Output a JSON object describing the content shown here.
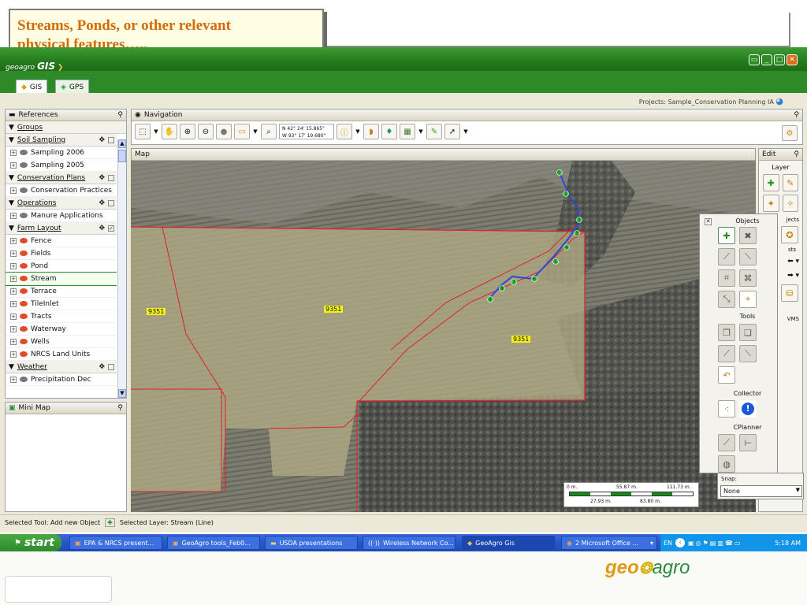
{
  "slide": {
    "caption_line1": "Streams, Ponds, or other relevant",
    "caption_line2": "physical features…..",
    "footer_logo_geo": "geo",
    "footer_logo_agro": "agro"
  },
  "window": {
    "logo_small": "geoagro",
    "logo_big": "GIS",
    "btn_restore": "▭",
    "btn_min": "_",
    "btn_max": "□",
    "btn_close": "✕",
    "colors": {
      "title_green": "#267d1f",
      "accent_orange": "#d46b07"
    }
  },
  "tabs": [
    {
      "label": "GIS"
    },
    {
      "label": "GPS"
    }
  ],
  "projects_label": "Projects: Sample_Conservation Planning IA",
  "references": {
    "title": "References",
    "groups_label": "Groups",
    "groups": [
      {
        "name": "Soil Sampling",
        "layers": [
          "Sampling 2006",
          "Sampling 2005"
        ]
      },
      {
        "name": "Conservation Plans",
        "layers": [
          "Conservation Practices"
        ]
      },
      {
        "name": "Operations",
        "layers": [
          "Manure Applications"
        ]
      },
      {
        "name": "Farm Layout",
        "layers": [
          "Fence",
          "Fields",
          "Pond",
          "Stream",
          "Terrace",
          "TileInlet",
          "Tracts",
          "Waterway",
          "Wells",
          "NRCS Land Units"
        ]
      },
      {
        "name": "Weather",
        "layers": [
          "Precipitation Dec"
        ]
      }
    ]
  },
  "minimap": {
    "title": "Mini Map"
  },
  "navigation": {
    "title": "Navigation",
    "coord_lat": "N 42° 24' 15.865\"",
    "coord_lon": "W 93° 17' 19.680\""
  },
  "map": {
    "title": "Map",
    "parcel_labels": [
      "9351",
      "9351",
      "9351"
    ],
    "stream_points": [
      "0",
      "1",
      "2",
      "3",
      "4",
      "5",
      "6",
      "7",
      "8",
      "9"
    ],
    "scale": {
      "top0": "0 m.",
      "top1": "55.87 m.",
      "top2": "111.73 m.",
      "bottom1": "27.93 m.",
      "bottom2": "83.80 m."
    }
  },
  "edit": {
    "title": "Edit",
    "layer_label": "Layer",
    "objects_partial": "jects",
    "sts_partial": "sts",
    "wms_partial": "VMS"
  },
  "objects_panel": {
    "objects": "Objects",
    "tools": "Tools",
    "collector": "Collector",
    "cplanner": "CPlanner",
    "snap_label": "Snap:",
    "snap_value": "None"
  },
  "status": {
    "selected_tool": "Selected Tool: Add new Object",
    "selected_layer": "Selected Layer: Stream (Line)"
  },
  "taskbar": {
    "start": "start",
    "tasks": [
      "EPA & NRCS present...",
      "GeoAgro tools_Feb0...",
      "USDA presentations",
      "Wireless Network Co...",
      "GeoAgro Gis",
      "2 Microsoft Office ..."
    ],
    "lang": "EN",
    "clock": "5:18 AM"
  }
}
